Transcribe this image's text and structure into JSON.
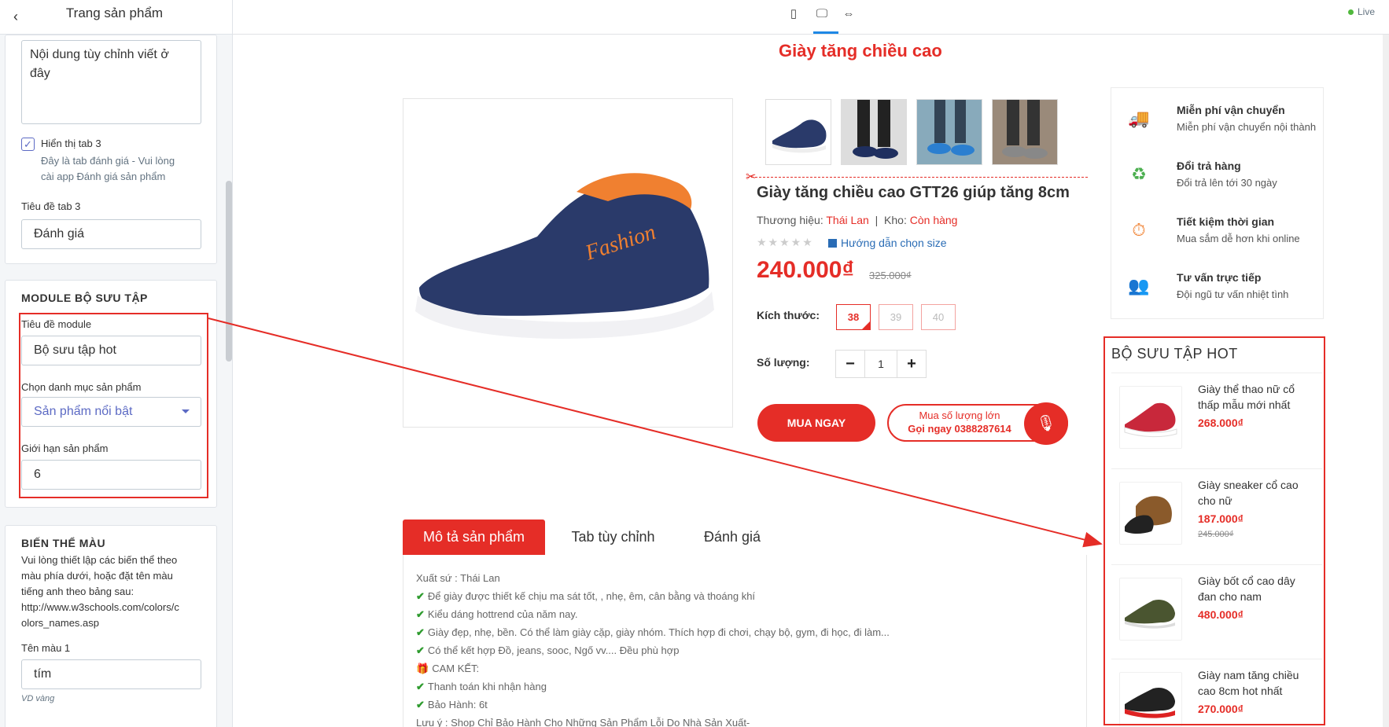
{
  "sidebar": {
    "title": "Trang sản phẩm",
    "custom_text": "Nội dung tùy chỉnh viết ở đây",
    "tab3_checkbox": "Hiển thị tab 3",
    "tab3_help_1": "Đây là tab đánh giá - Vui lòng",
    "tab3_help_2": "cài app Đánh giá sản phẩm",
    "tab3_title_label": "Tiêu đề tab 3",
    "tab3_title_value": "Đánh giá",
    "module": {
      "heading": "MODULE BỘ SƯU TẬP",
      "title_label": "Tiêu đề module",
      "title_value": "Bộ sưu tập hot",
      "category_label": "Chọn danh mục sản phẩm",
      "category_value": "Sản phẩm nổi bật",
      "limit_label": "Giới hạn sản phẩm",
      "limit_value": "6"
    },
    "variant": {
      "heading": "BIẾN THỂ MÀU",
      "help_1": "Vui lòng thiết lập các biến thể theo",
      "help_2": "màu phía dưới, hoặc đặt tên màu",
      "help_3": "tiếng anh theo bảng sau:",
      "help_4": "http://www.w3schools.com/colors/c",
      "help_5": "olors_names.asp",
      "color1_label": "Tên màu 1",
      "color1_value": "tím",
      "color1_hint": "VD vàng"
    }
  },
  "topbar": {
    "live": "Live",
    "devices": [
      "mobile-icon",
      "desktop-icon",
      "fullscreen-icon"
    ]
  },
  "product": {
    "page_title": "Giày tăng chiều cao",
    "name": "Giày tăng chiều cao GTT26 giúp tăng 8cm",
    "brand_label": "Thương hiệu:",
    "brand": "Thái Lan",
    "separator": "|",
    "stock_label": "Kho:",
    "stock": "Còn hàng",
    "size_guide": "Hướng dẫn chọn size",
    "price": "240.000₫",
    "old_price": "325.000₫",
    "size_label": "Kích thước:",
    "sizes": [
      "38",
      "39",
      "40"
    ],
    "qty_label": "Số lượng:",
    "qty": "1",
    "buy_now": "MUA NGAY",
    "bulk_1": "Mua số lượng lớn",
    "bulk_2": "Gọi ngay 0388287614"
  },
  "services": [
    {
      "title": "Miễn phí vận chuyển",
      "desc": "Miễn phí vận chuyển nội thành",
      "icon": "truck-icon"
    },
    {
      "title": "Đổi trả hàng",
      "desc": "Đổi trả lên tới 30 ngày",
      "icon": "refresh-icon"
    },
    {
      "title": "Tiết kiệm thời gian",
      "desc": "Mua sắm dễ hơn khi online",
      "icon": "clock-icon"
    },
    {
      "title": "Tư vấn trực tiếp",
      "desc": "Đội ngũ tư vấn nhiệt tình",
      "icon": "support-icon"
    }
  ],
  "collection": {
    "title": "BỘ SƯU TẬP HOT",
    "items": [
      {
        "name": "Giày thể thao nữ cổ thấp mẫu mới nhất",
        "price": "268.000₫",
        "old": ""
      },
      {
        "name": "Giày sneaker cổ cao cho nữ",
        "price": "187.000₫",
        "old": "245.000₫"
      },
      {
        "name": "Giày bốt cổ cao dây đan cho nam",
        "price": "480.000₫",
        "old": ""
      },
      {
        "name": "Giày nam tăng chiều cao 8cm hot nhất",
        "price": "270.000₫",
        "old": ""
      }
    ]
  },
  "tabs": [
    "Mô tả sản phẩm",
    "Tab tùy chỉnh",
    "Đánh giá"
  ],
  "description": [
    "Xuất sứ : Thái Lan",
    "Để giày được thiết kế chịu ma sát tốt, , nhẹ, êm, cân bằng và thoáng khí",
    "Kiểu dáng hottrend của năm nay.",
    "Giày đẹp, nhẹ, bền. Có thể làm giày cặp, giày nhóm. Thích hợp đi chơi, chạy bộ, gym, đi học, đi làm...",
    "Có thể kết hợp Đồ, jeans, sooc, Ngố vv.... Đều phù hợp",
    "CAM KẾT:",
    "Thanh toán khi nhận hàng",
    "Bảo Hành: 6t",
    "Lưu ý : Shop Chỉ Bảo Hành Cho Những Sản Phẩm Lỗi Do Nhà Sản Xuất-"
  ],
  "colors": {
    "accent": "#e52d27",
    "admin_accent": "#5c6ac4",
    "link": "#2a6cb5"
  }
}
